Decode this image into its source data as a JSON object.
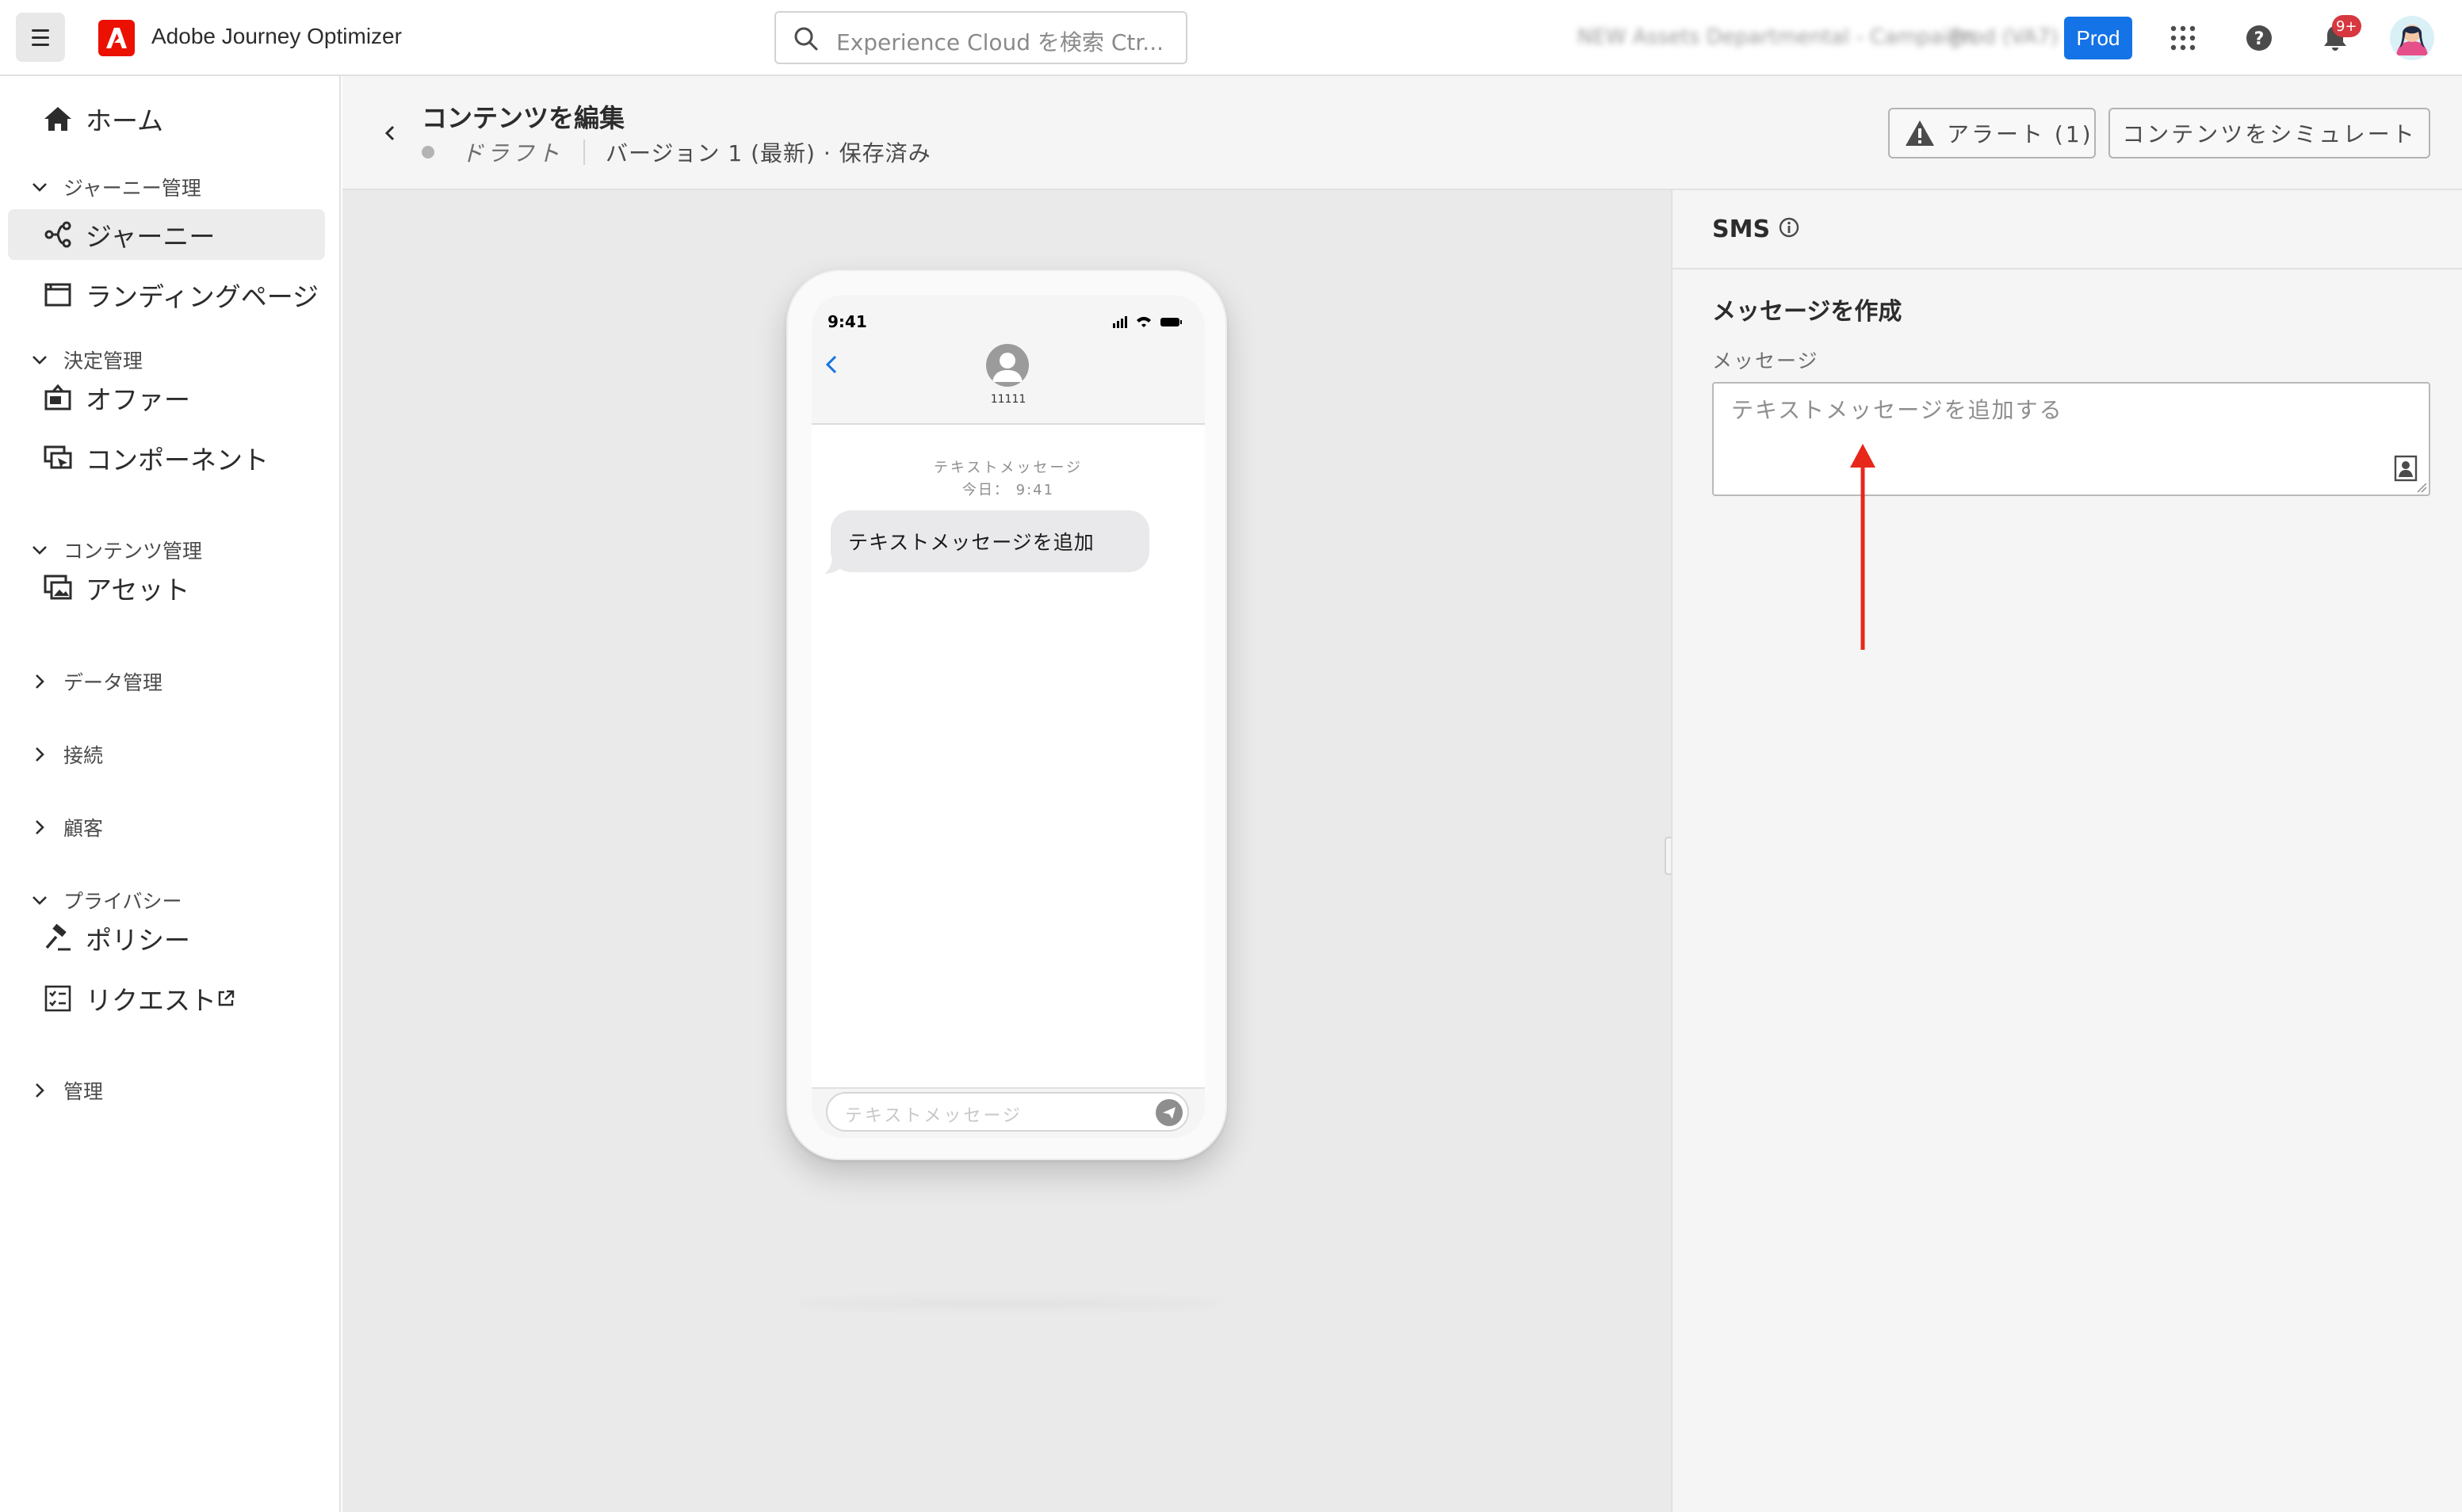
{
  "topbar": {
    "app_title": "Adobe Journey Optimizer",
    "search_placeholder": "Experience Cloud を検索 Ctr...",
    "org_name": "NEW Assets Departmental - Campaign",
    "org_id": "Prod (VA7)",
    "env_badge": "Prod",
    "notification_count": "9+"
  },
  "sidebar": {
    "home": "ホーム",
    "sections": [
      {
        "label": "ジャーニー管理",
        "expanded": true,
        "items": [
          "ジャーニー",
          "ランディングページ"
        ]
      },
      {
        "label": "決定管理",
        "expanded": true,
        "items": [
          "オファー",
          "コンポーネント"
        ]
      },
      {
        "label": "コンテンツ管理",
        "expanded": true,
        "items": [
          "アセット"
        ]
      },
      {
        "label": "データ管理",
        "expanded": false,
        "items": []
      },
      {
        "label": "接続",
        "expanded": false,
        "items": []
      },
      {
        "label": "顧客",
        "expanded": false,
        "items": []
      },
      {
        "label": "プライバシー",
        "expanded": true,
        "items": [
          "ポリシー",
          "リクエスト"
        ]
      },
      {
        "label": "管理",
        "expanded": false,
        "items": []
      }
    ],
    "active_item": "ジャーニー"
  },
  "header": {
    "title": "コンテンツを編集",
    "status": "ドラフト",
    "version": "バージョン 1 (最新) · 保存済み",
    "alert_button": "アラート (1)",
    "simulate_button": "コンテンツをシミュレート"
  },
  "phone": {
    "time": "9:41",
    "contact_name": "11111",
    "meta_label": "テキストメッセージ",
    "meta_time": "今日： 9:41",
    "bubble_text": "テキストメッセージを追加",
    "input_placeholder": "テキストメッセージ"
  },
  "panel": {
    "title": "SMS",
    "section_title": "メッセージを作成",
    "message_label": "メッセージ",
    "message_placeholder": "テキストメッセージを追加する"
  },
  "colors": {
    "accent": "#1473e6",
    "adobe_red": "#eb1000",
    "annotation_arrow": "#e8271b"
  }
}
